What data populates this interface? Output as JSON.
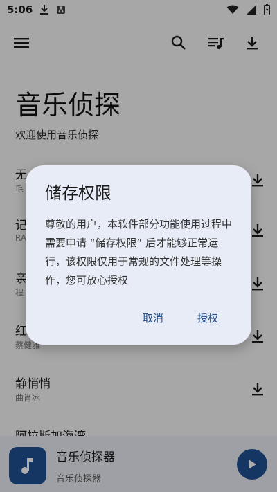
{
  "status_bar": {
    "time": "5:06"
  },
  "header": {
    "title": "音乐侦探",
    "subtitle": "欢迎使用音乐侦探"
  },
  "songs": [
    {
      "title": "无",
      "artist": "毛"
    },
    {
      "title": "记",
      "artist": "RA"
    },
    {
      "title": "亲",
      "artist": "程"
    },
    {
      "title": "红",
      "artist": "蔡健雅"
    },
    {
      "title": "静悄悄",
      "artist": "曲肖冰"
    },
    {
      "title": "阿拉斯加海湾",
      "artist": ""
    }
  ],
  "player": {
    "title": "音乐侦探器",
    "subtitle": "音乐侦探器"
  },
  "dialog": {
    "title": "储存权限",
    "body": "尊敬的用户，本软件部分功能使用过程中需要申请 “储存权限” 后才能够正常运行，该权限仅用于常规的文件处理等操作，您可放心授权",
    "cancel_label": "取消",
    "grant_label": "授权"
  },
  "colors": {
    "accent": "#1f4f91",
    "dialog_bg": "#e7ecf6",
    "player_bg": "#e9ecf3"
  }
}
